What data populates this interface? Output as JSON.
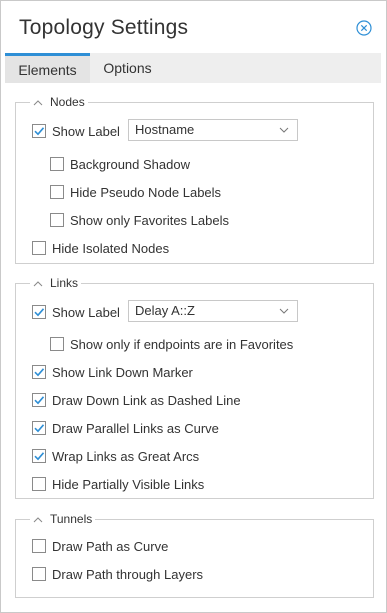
{
  "window": {
    "title": "Topology Settings",
    "close_icon": "close-circle-icon"
  },
  "tabs": [
    {
      "label": "Elements",
      "active": true
    },
    {
      "label": "Options",
      "active": false
    }
  ],
  "accent_color": "#2e8fd6",
  "nodes": {
    "legend": "Nodes",
    "show_label": {
      "label": "Show Label",
      "checked": true
    },
    "label_select": {
      "value": "Hostname"
    },
    "background_shadow": {
      "label": "Background Shadow",
      "checked": false
    },
    "hide_pseudo": {
      "label": "Hide Pseudo Node Labels",
      "checked": false
    },
    "show_favorites": {
      "label": "Show only Favorites Labels",
      "checked": false
    },
    "hide_isolated": {
      "label": "Hide Isolated Nodes",
      "checked": false
    }
  },
  "links": {
    "legend": "Links",
    "show_label": {
      "label": "Show Label",
      "checked": true
    },
    "label_select": {
      "value": "Delay A::Z"
    },
    "endpoints_favorites": {
      "label": "Show only if endpoints are in Favorites",
      "checked": false
    },
    "link_down_marker": {
      "label": "Show Link Down Marker",
      "checked": true
    },
    "down_dashed": {
      "label": "Draw Down Link as Dashed Line",
      "checked": true
    },
    "parallel_curve": {
      "label": "Draw Parallel Links as Curve",
      "checked": true
    },
    "great_arcs": {
      "label": "Wrap Links as Great Arcs",
      "checked": true
    },
    "hide_partial": {
      "label": "Hide Partially Visible Links",
      "checked": false
    }
  },
  "tunnels": {
    "legend": "Tunnels",
    "path_curve": {
      "label": "Draw Path as Curve",
      "checked": false
    },
    "path_layers": {
      "label": "Draw Path through Layers",
      "checked": false
    }
  }
}
